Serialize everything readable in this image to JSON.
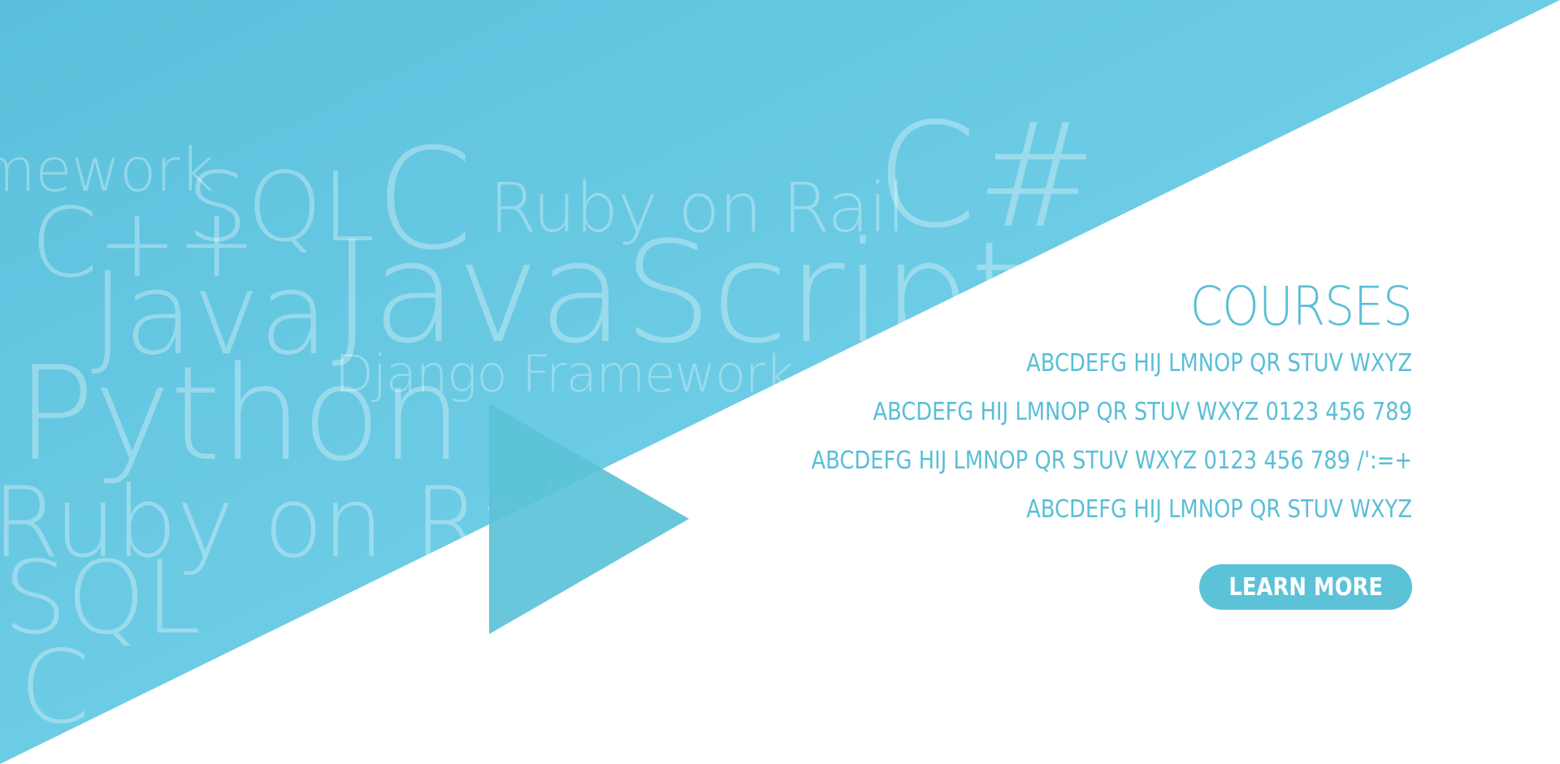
{
  "background_words": [
    {
      "text": "mework"
    },
    {
      "text": "SQL"
    },
    {
      "text": "C"
    },
    {
      "text": "Ruby on Rail"
    },
    {
      "text": "C#"
    },
    {
      "text": "C++"
    },
    {
      "text": "JavaScript"
    },
    {
      "text": "Java"
    },
    {
      "text": "Django Framework"
    },
    {
      "text": "Python"
    },
    {
      "text": "Ruby on Rail"
    },
    {
      "text": "SQL"
    },
    {
      "text": "C"
    }
  ],
  "content": {
    "title": "COURSES",
    "lines": [
      "ABCDEFG HIJ LMNOP QR STUV WXYZ",
      "ABCDEFG HIJ LMNOP QR STUV WXYZ 0123 456 789",
      "ABCDEFG HIJ LMNOP QR STUV WXYZ 0123 456 789 /':=+",
      "ABCDEFG HIJ LMNOP QR STUV WXYZ"
    ],
    "cta_label": "LEARN MORE"
  },
  "colors": {
    "primary": "#5bc2d8",
    "primary_light": "#76d0e8",
    "text_accent": "#59bfd6",
    "background": "#ffffff"
  },
  "icons": {
    "play": "play-icon"
  }
}
